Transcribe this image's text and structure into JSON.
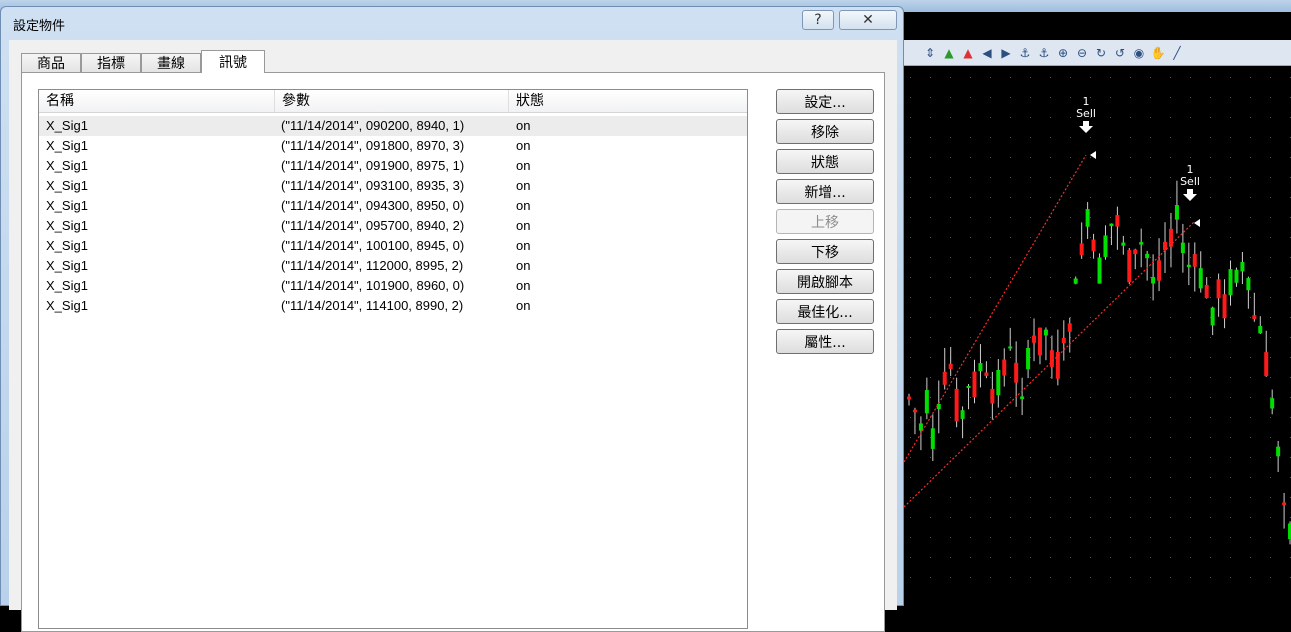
{
  "dialog": {
    "title": "設定物件",
    "help_label": "?",
    "close_label": "✕",
    "tabs": [
      {
        "label": "商品",
        "active": false
      },
      {
        "label": "指標",
        "active": false
      },
      {
        "label": "畫線",
        "active": false
      },
      {
        "label": "訊號",
        "active": true
      }
    ],
    "columns": [
      "名稱",
      "參數",
      "狀態"
    ],
    "rows": [
      {
        "name": "X_Sig1",
        "params": "(\"11/14/2014\", 090200, 8940, 1)",
        "status": "on",
        "selected": true
      },
      {
        "name": "X_Sig1",
        "params": "(\"11/14/2014\", 091800, 8970, 3)",
        "status": "on"
      },
      {
        "name": "X_Sig1",
        "params": "(\"11/14/2014\", 091900, 8975, 1)",
        "status": "on"
      },
      {
        "name": "X_Sig1",
        "params": "(\"11/14/2014\", 093100, 8935, 3)",
        "status": "on"
      },
      {
        "name": "X_Sig1",
        "params": "(\"11/14/2014\", 094300, 8950, 0)",
        "status": "on"
      },
      {
        "name": "X_Sig1",
        "params": "(\"11/14/2014\", 095700, 8940, 2)",
        "status": "on"
      },
      {
        "name": "X_Sig1",
        "params": "(\"11/14/2014\", 100100, 8945, 0)",
        "status": "on"
      },
      {
        "name": "X_Sig1",
        "params": "(\"11/14/2014\", 112000, 8995, 2)",
        "status": "on"
      },
      {
        "name": "X_Sig1",
        "params": "(\"11/14/2014\", 101900, 8960, 0)",
        "status": "on"
      },
      {
        "name": "X_Sig1",
        "params": "(\"11/14/2014\", 114100, 8990, 2)",
        "status": "on"
      }
    ],
    "buttons": [
      {
        "label": "設定...",
        "enabled": true
      },
      {
        "label": "移除",
        "enabled": true
      },
      {
        "label": "狀態",
        "enabled": true
      },
      {
        "label": "新增...",
        "enabled": true
      },
      {
        "label": "上移",
        "enabled": false
      },
      {
        "label": "下移",
        "enabled": true
      },
      {
        "label": "開啟腳本",
        "enabled": true
      },
      {
        "label": "最佳化...",
        "enabled": true
      },
      {
        "label": "屬性...",
        "enabled": true
      }
    ]
  },
  "background_chart": {
    "markers": [
      {
        "count": "1",
        "label": "Sell"
      },
      {
        "count": "1",
        "label": "Sell"
      }
    ],
    "colors": {
      "up": "#00e000",
      "down": "#ff1a1a",
      "background": "#000000",
      "grid": "#3a3a3a"
    }
  },
  "toolbar_icons": [
    "arrows-updown-icon",
    "arrow-up-icon",
    "arrow-up-red-icon",
    "arrow-left-icon",
    "arrow-right-icon",
    "anchor-icon",
    "anchor2-icon",
    "zoom-in-icon",
    "zoom-out-icon",
    "rotate-icon",
    "rotate2-icon",
    "eye-icon",
    "hand-icon",
    "line-tool-icon"
  ]
}
